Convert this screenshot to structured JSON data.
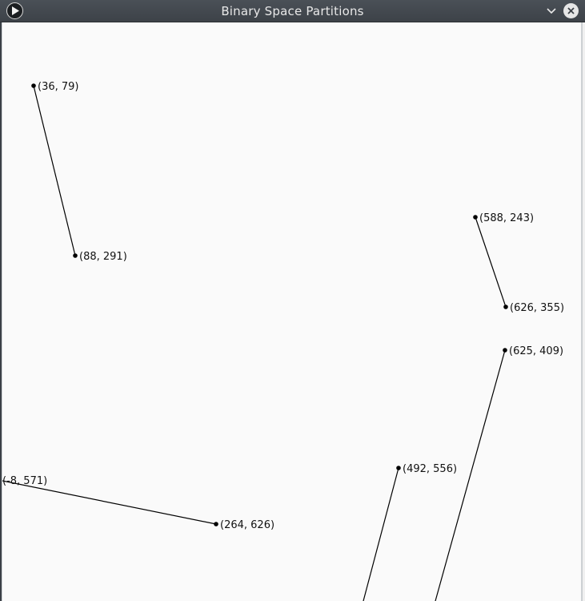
{
  "window": {
    "title": "Binary Space Partitions",
    "icons": {
      "app": "play-icon",
      "minimize": "chevron-down-icon",
      "close": "close-icon"
    }
  },
  "segments": [
    {
      "a": {
        "label": "(36, 79)"
      },
      "b": {
        "label": "(88, 291)"
      }
    },
    {
      "a": {
        "label": "(588, 243)"
      },
      "b": {
        "label": "(626, 355)"
      }
    },
    {
      "a": {
        "label": "(625, 409)"
      },
      "b": {
        "label": ""
      }
    },
    {
      "a": {
        "label": "(492, 556)"
      },
      "b": {
        "label": ""
      }
    },
    {
      "a": {
        "label": "(-8, 571)"
      },
      "b": {
        "label": "(264, 626)"
      }
    }
  ]
}
